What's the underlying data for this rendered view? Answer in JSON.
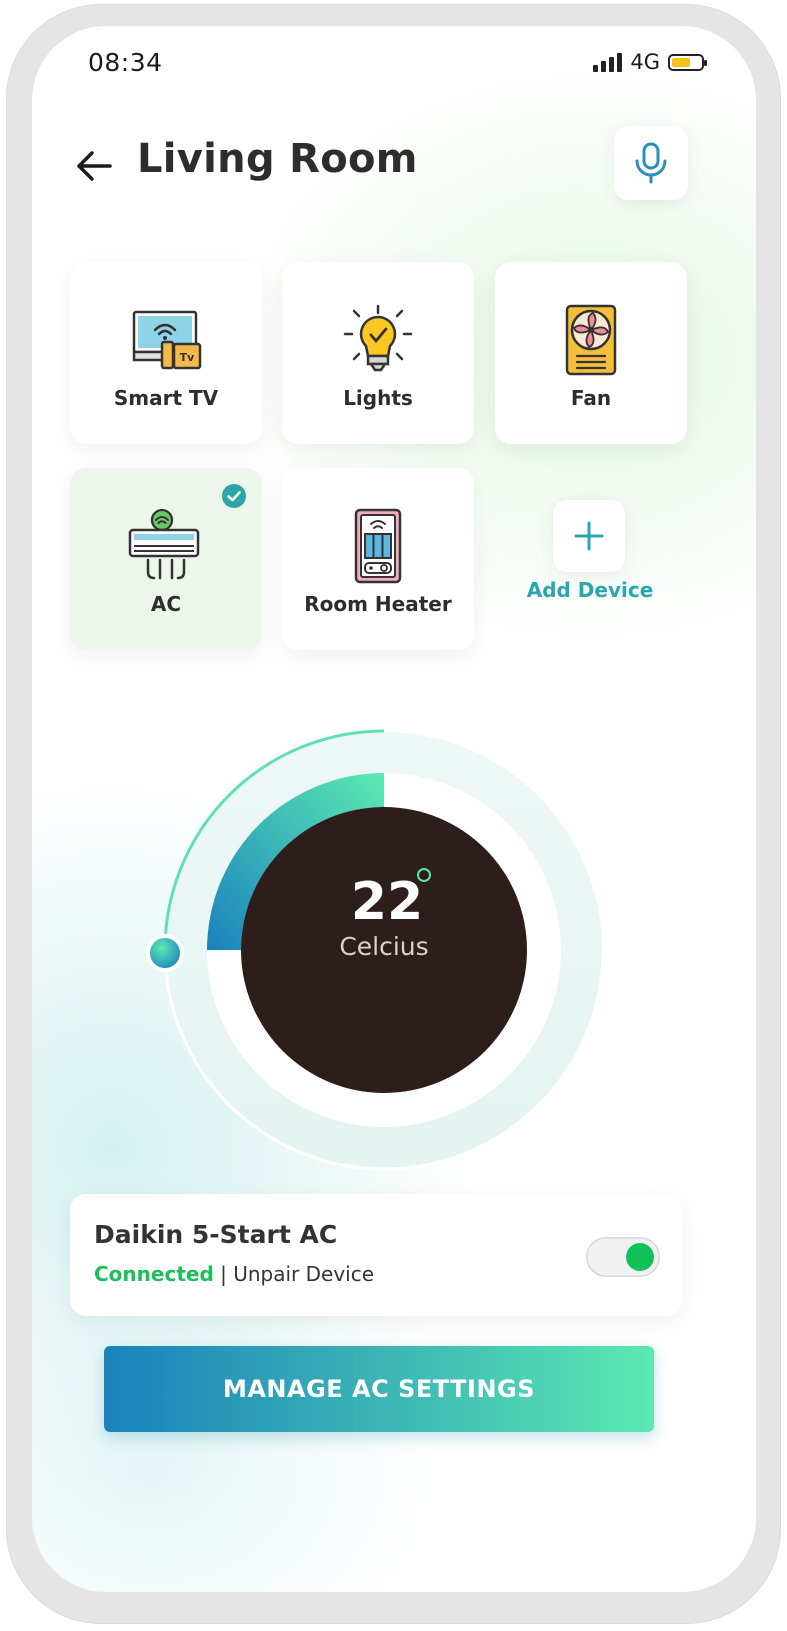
{
  "status": {
    "time": "08:34",
    "network": "4G",
    "battery_level": 0.55
  },
  "header": {
    "title": "Living Room"
  },
  "devices": [
    {
      "label": "Smart TV",
      "icon": "smart-tv-icon",
      "selected": false
    },
    {
      "label": "Lights",
      "icon": "light-bulb-icon",
      "selected": false
    },
    {
      "label": "Fan",
      "icon": "fan-icon",
      "selected": false
    },
    {
      "label": "AC",
      "icon": "air-conditioner-icon",
      "selected": true
    },
    {
      "label": "Room Heater",
      "icon": "room-heater-icon",
      "selected": false
    }
  ],
  "add_device": {
    "label": "Add Device"
  },
  "thermostat": {
    "value": "22",
    "unit": "Celcius",
    "level": 0.25
  },
  "device_info": {
    "name": "Daikin 5-Start AC",
    "status": "Connected",
    "separator": "|",
    "unpair": "Unpair Device",
    "power_on": true
  },
  "action": {
    "label": "MANAGE AC SETTINGS"
  },
  "colors": {
    "accent": "#2aa6b0",
    "connected": "#1bbf5c",
    "dial_center": "#2d1d1b",
    "gradient_start": "#1a82bd",
    "gradient_end": "#5ce9b2"
  }
}
